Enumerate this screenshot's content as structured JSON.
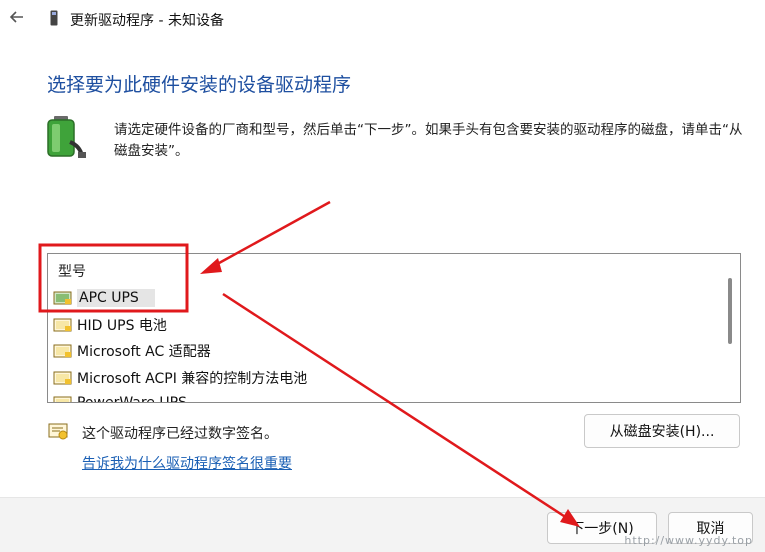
{
  "window": {
    "title": "更新驱动程序 - 未知设备",
    "back_icon": "back-arrow-icon",
    "device_icon": "device-icon"
  },
  "main": {
    "heading": "选择要为此硬件安装的设备驱动程序",
    "instructions": "请选定硬件设备的厂商和型号，然后单击“下一步”。如果手头有包含要安装的驱动程序的磁盘，请单击“从磁盘安装”。"
  },
  "list": {
    "header": "型号",
    "items": [
      {
        "label": "APC UPS",
        "selected": true
      },
      {
        "label": "HID UPS 电池",
        "selected": false
      },
      {
        "label": "Microsoft AC 适配器",
        "selected": false
      },
      {
        "label": "Microsoft ACPI 兼容的控制方法电池",
        "selected": false
      },
      {
        "label": "PowerWare UPS",
        "selected": false
      }
    ]
  },
  "signature": {
    "status_text": "这个驱动程序已经过数字签名。",
    "link_text": "告诉我为什么驱动程序签名很重要",
    "have_disk_label": "从磁盘安装(H)..."
  },
  "footer": {
    "next_label": "下一步(N)",
    "cancel_label": "取消"
  },
  "watermark": "http://www.yydy.top",
  "colors": {
    "accent_heading": "#1e4fa0",
    "link": "#1a5fb4",
    "annotation_red": "#e0191c"
  }
}
